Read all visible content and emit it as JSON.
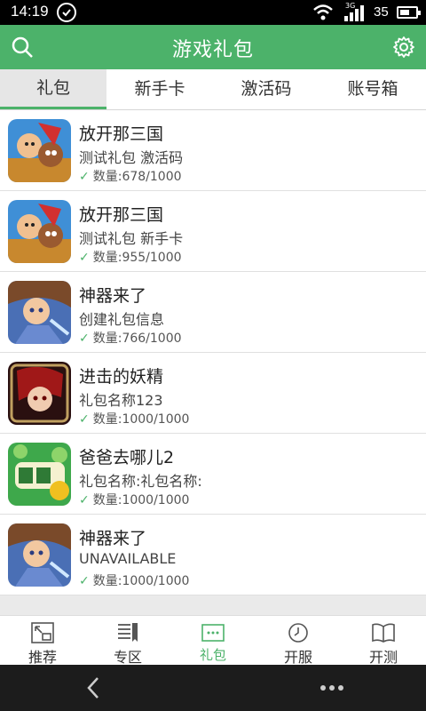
{
  "status": {
    "time": "14:19",
    "battery": "35",
    "network": "3G"
  },
  "header": {
    "title": "游戏礼包",
    "search_icon": "search-icon",
    "settings_icon": "gear-icon"
  },
  "tabs": [
    {
      "label": "礼包",
      "active": true
    },
    {
      "label": "新手卡",
      "active": false
    },
    {
      "label": "激活码",
      "active": false
    },
    {
      "label": "账号箱",
      "active": false
    }
  ],
  "gifts": [
    {
      "name": "放开那三国",
      "desc": "测试礼包 激活码",
      "qty": "数量:678/1000",
      "icon": "fangkai-sanguo-icon",
      "color": "#3f8fd6"
    },
    {
      "name": "放开那三国",
      "desc": "测试礼包  新手卡",
      "qty": "数量:955/1000",
      "icon": "fangkai-sanguo-icon",
      "color": "#3f8fd6"
    },
    {
      "name": "神器来了",
      "desc": "创建礼包信息",
      "qty": "数量:766/1000",
      "icon": "shenqi-laile-icon",
      "color": "#4a6fb5"
    },
    {
      "name": "进击的妖精",
      "desc": "礼包名称123",
      "qty": "数量:1000/1000",
      "icon": "jinji-yaojing-icon",
      "color": "#8a1f1f"
    },
    {
      "name": "爸爸去哪儿2",
      "desc": "礼包名称:礼包名称:",
      "qty": "数量:1000/1000",
      "icon": "baba-quna-icon",
      "color": "#3ea84b"
    },
    {
      "name": "神器来了",
      "desc": "UNAVAILABLE",
      "qty": "数量:1000/1000",
      "icon": "shenqi-laile-icon",
      "color": "#4a6fb5"
    }
  ],
  "bottom_nav": [
    {
      "label": "推荐",
      "icon": "recommend-icon",
      "active": false
    },
    {
      "label": "专区",
      "icon": "zone-icon",
      "active": false
    },
    {
      "label": "礼包",
      "icon": "gift-icon",
      "active": true
    },
    {
      "label": "开服",
      "icon": "clock-icon",
      "active": false
    },
    {
      "label": "开测",
      "icon": "book-icon",
      "active": false
    }
  ],
  "colors": {
    "brand": "#4cb26a",
    "header": "#4cb26a"
  }
}
